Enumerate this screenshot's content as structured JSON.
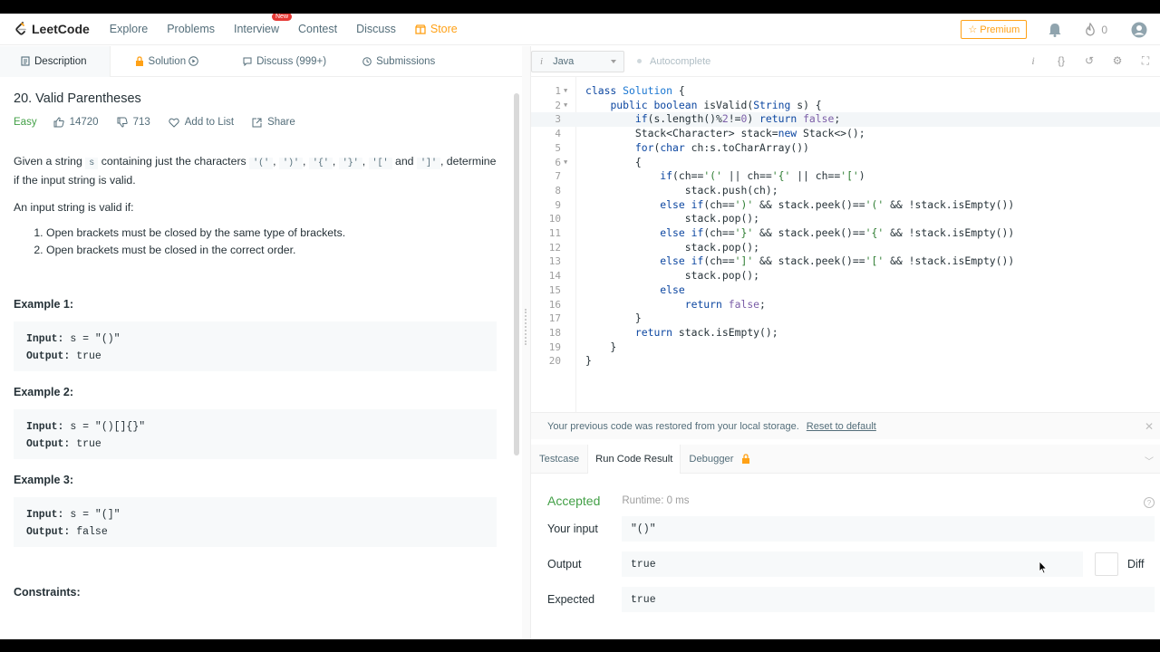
{
  "nav": {
    "logo": "LeetCode",
    "items": [
      "Explore",
      "Problems",
      "Interview",
      "Contest",
      "Discuss"
    ],
    "new_badge": "New",
    "store": "Store",
    "premium": "☆ Premium",
    "streak": "0"
  },
  "left_tabs": {
    "description": "Description",
    "solution": "Solution",
    "discuss": "Discuss (999+)",
    "submissions": "Submissions"
  },
  "problem": {
    "title": "20. Valid Parentheses",
    "difficulty": "Easy",
    "likes": "14720",
    "dislikes": "713",
    "add_to_list": "Add to List",
    "share": "Share",
    "desc_pre": "Given a string",
    "desc_s": "s",
    "desc_mid": "containing just the characters",
    "chars": [
      "'('",
      "')'",
      "'{'",
      "'}'",
      "'['"
    ],
    "and": "and",
    "last_char": "']'",
    "desc_tail": "determine if the input string is valid.",
    "valid_if": "An input string is valid if:",
    "rules": [
      "Open brackets must be closed by the same type of brackets.",
      "Open brackets must be closed in the correct order."
    ],
    "examples": [
      {
        "title": "Example 1:",
        "input_label": "Input:",
        "input": " s = \"()\"",
        "output_label": "Output:",
        "output": " true"
      },
      {
        "title": "Example 2:",
        "input_label": "Input:",
        "input": " s = \"()[]{}\"",
        "output_label": "Output:",
        "output": " true"
      },
      {
        "title": "Example 3:",
        "input_label": "Input:",
        "input": " s = \"(]\"",
        "output_label": "Output:",
        "output": " false"
      }
    ],
    "constraints": "Constraints:"
  },
  "editor": {
    "language": "Java",
    "autocomplete": "Autocomplete"
  },
  "restore": {
    "message": "Your previous code was restored from your local storage.",
    "reset": "Reset to default"
  },
  "result_tabs": {
    "testcase": "Testcase",
    "run_result": "Run Code Result",
    "debugger": "Debugger"
  },
  "result": {
    "status": "Accepted",
    "runtime": "Runtime: 0 ms",
    "your_input_label": "Your input",
    "your_input": "\"()\"",
    "output_label": "Output",
    "output": "true",
    "expected_label": "Expected",
    "expected": "true",
    "diff": "Diff"
  },
  "colors": {
    "accent": "#ffa116",
    "accepted": "#43a047"
  }
}
